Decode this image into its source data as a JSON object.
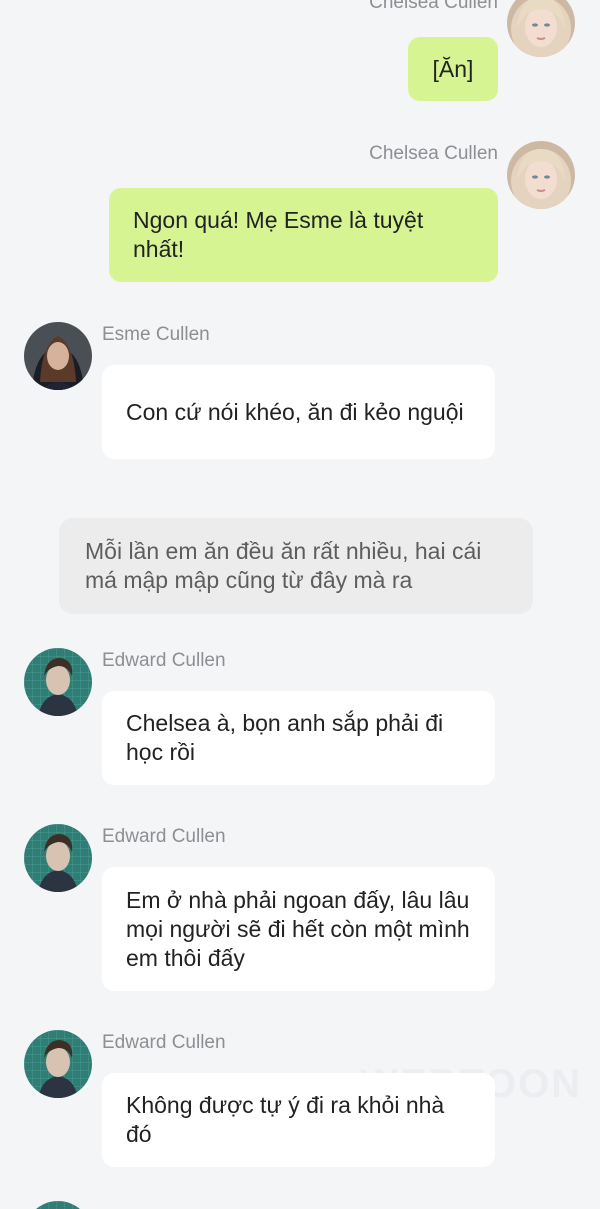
{
  "messages": [
    {
      "sender": "Chelsea Cullen",
      "text": "[Ăn]",
      "side": "right"
    },
    {
      "sender": "Chelsea Cullen",
      "text": "Ngon quá! Mẹ Esme là tuyệt nhất!",
      "side": "right"
    },
    {
      "sender": "Esme Cullen",
      "text": "Con cứ nói khéo, ăn đi kẻo nguội",
      "side": "left"
    },
    {
      "narration": "Mỗi lần em ăn đều ăn rất nhiều, hai cái má mập mập cũng từ đây mà ra"
    },
    {
      "sender": "Edward Cullen",
      "text": "Chelsea à, bọn anh sắp phải đi học rồi",
      "side": "left"
    },
    {
      "sender": "Edward Cullen",
      "text": "Em ở nhà phải ngoan đấy, lâu lâu mọi người sẽ đi hết còn một mình em thôi đấy",
      "side": "left"
    },
    {
      "sender": "Edward Cullen",
      "text": "Không được tự ý đi ra khỏi nhà đó",
      "side": "left"
    }
  ],
  "colors": {
    "background": "#f4f5f7",
    "my_bubble": "#d6f492",
    "other_bubble": "#ffffff",
    "narration_bubble": "#ececec",
    "name_text": "#8e8e93"
  },
  "icons": {
    "chelsea": "avatar-chelsea",
    "esme": "avatar-esme",
    "edward": "avatar-edward"
  },
  "watermark": "WEBTOON"
}
